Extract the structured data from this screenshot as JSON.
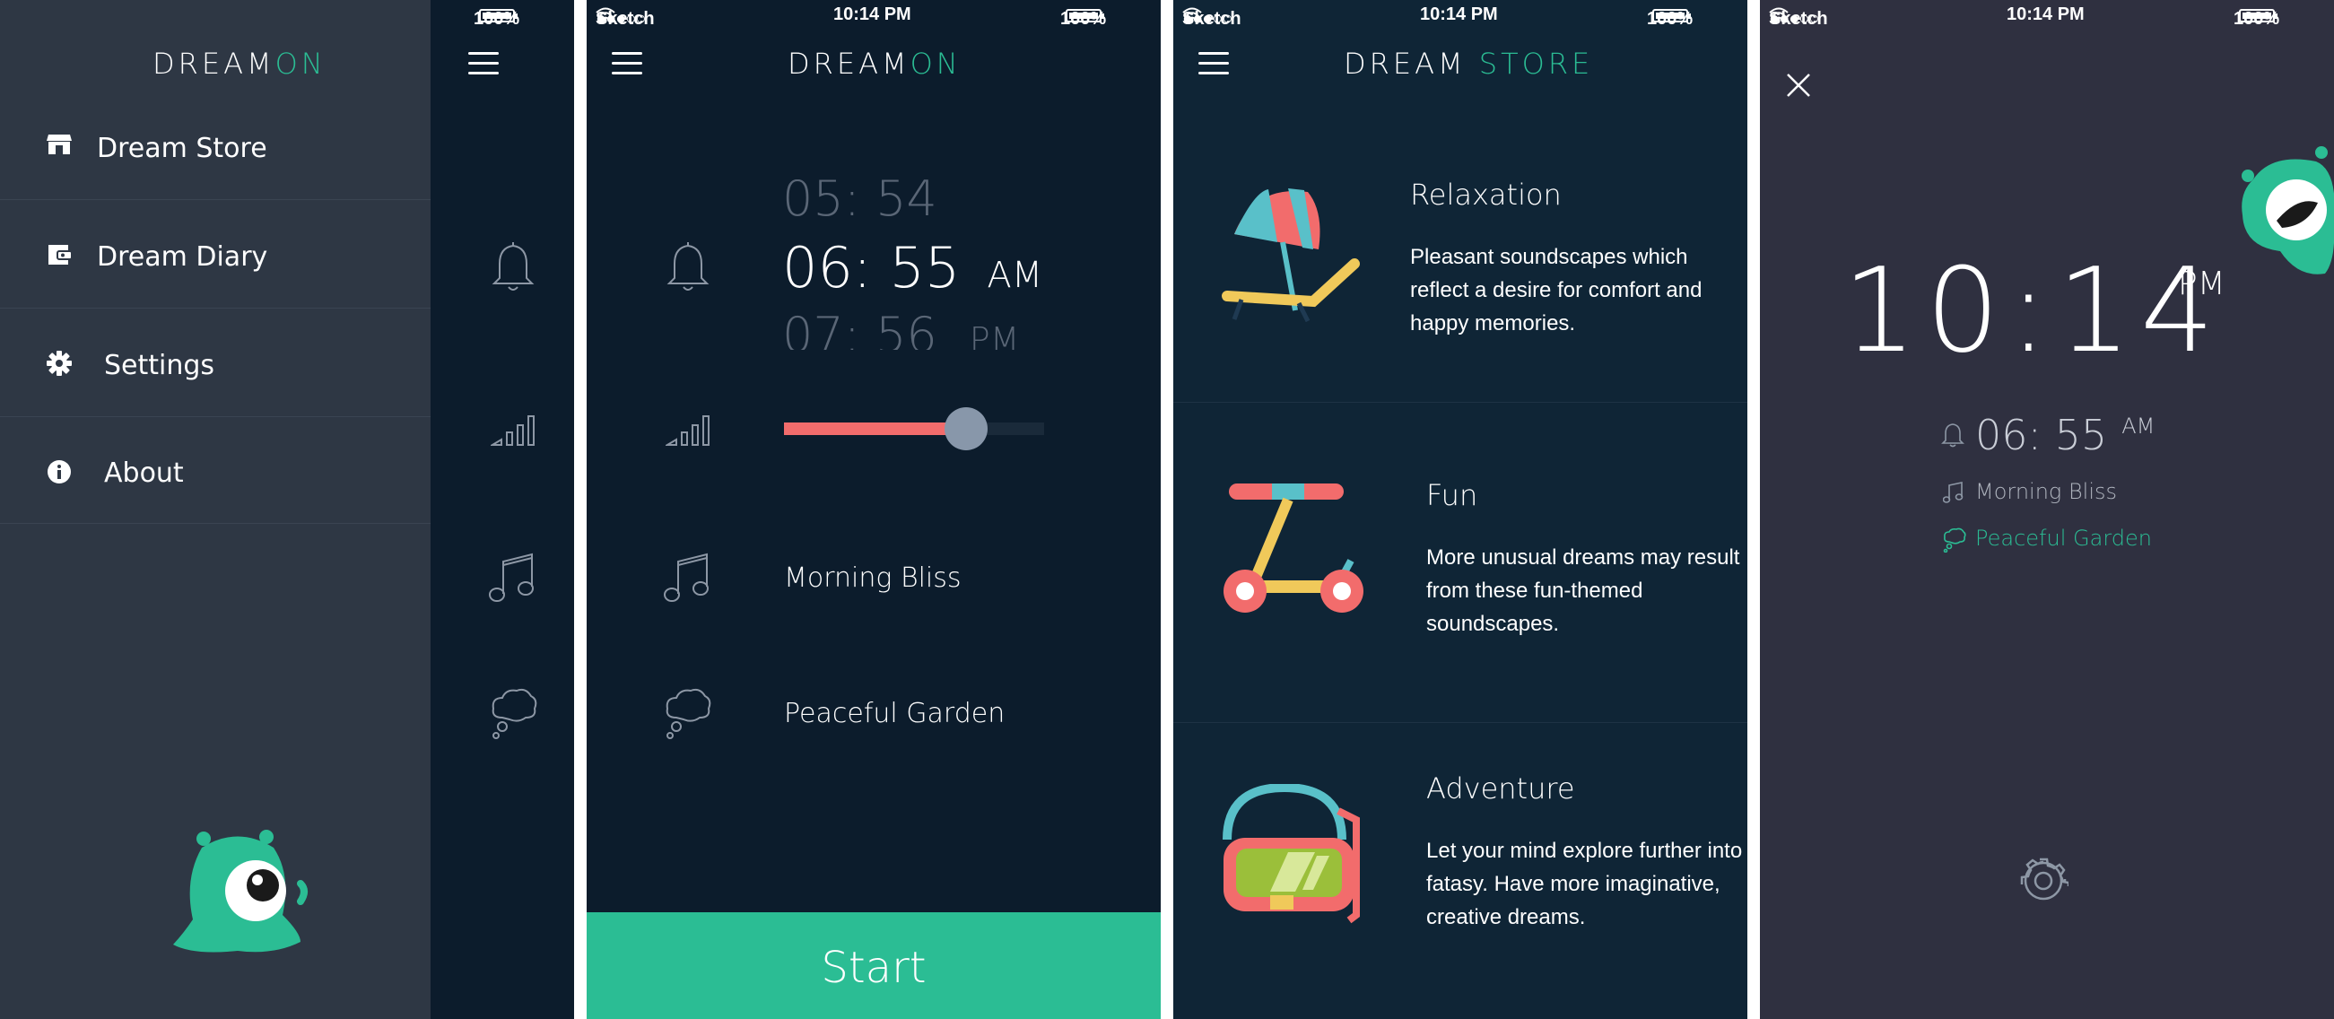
{
  "colors": {
    "accent": "#2bbd94",
    "coral": "#f26c6c",
    "menu_bg": "#2e3744",
    "dark_bg": "#0c1c2c",
    "store_bg": "#0f2536",
    "clock_bg": "#2f3040",
    "muted": "#8d97a5"
  },
  "status": {
    "carrier": "Sketch",
    "time": "10:14 PM",
    "battery": "100%",
    "signal": "●●●○○"
  },
  "menu": {
    "logo_a": "DREAM",
    "logo_b": "ON",
    "items": [
      {
        "label": "Dream Store",
        "icon": "store-icon"
      },
      {
        "label": "Dream Diary",
        "icon": "diary-icon"
      },
      {
        "label": "Settings",
        "icon": "gear-icon"
      },
      {
        "label": "About",
        "icon": "info-icon"
      }
    ],
    "peek_battery": "100%"
  },
  "alarm": {
    "logo_a": "DREAM",
    "logo_b": "ON",
    "time_prev": "05: 54",
    "time_selected": "06: 55",
    "ampm_selected": "AM",
    "time_next": "07: 56",
    "ampm_next": "PM",
    "volume": 0.7,
    "sound": "Morning Bliss",
    "dream": "Peaceful Garden",
    "start_label": "Start"
  },
  "store": {
    "title_a": "DREAM",
    "title_b": "STORE",
    "items": [
      {
        "title": "Relaxation",
        "desc1": "Pleasant soundscapes which",
        "desc2": "reflect a desire for comfort and",
        "desc3": "happy memories."
      },
      {
        "title": "Fun",
        "desc1": "More unusual dreams may result",
        "desc2": "from these fun-themed",
        "desc3": "soundscapes."
      },
      {
        "title": "Adventure",
        "desc1": "Let your mind explore further into",
        "desc2": "fatasy. Have more imaginative,",
        "desc3": "creative dreams."
      }
    ]
  },
  "clock": {
    "time": "10:14",
    "ampm": "PM",
    "alarm_time": "06: 55",
    "alarm_ampm": "AM",
    "sound": "Morning Bliss",
    "dream": "Peaceful Garden"
  }
}
